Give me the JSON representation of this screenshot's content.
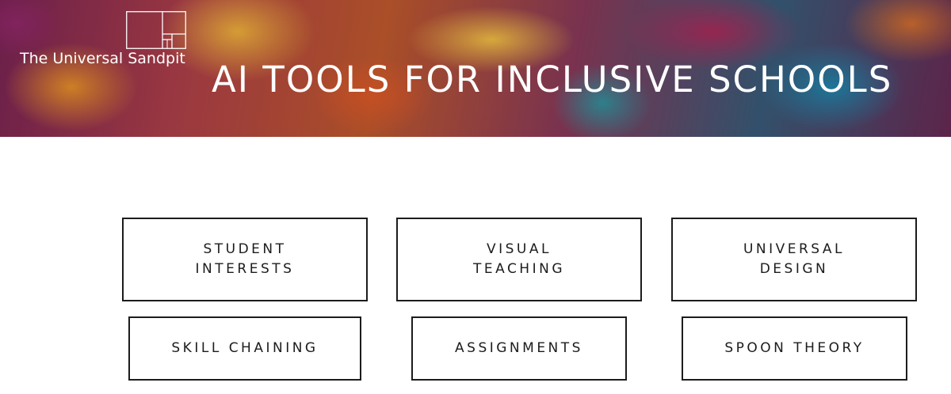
{
  "header": {
    "logo_text": "The Universal Sandpit",
    "title": "AI TOOLS FOR INCLUSIVE SCHOOLS"
  },
  "tiles": [
    {
      "label_line1": "STUDENT",
      "label_line2": "INTERESTS"
    },
    {
      "label_line1": "VISUAL",
      "label_line2": "TEACHING"
    },
    {
      "label_line1": "UNIVERSAL",
      "label_line2": "DESIGN"
    },
    {
      "label_line1": "SKILL CHAINING",
      "label_line2": ""
    },
    {
      "label_line1": "ASSIGNMENTS",
      "label_line2": ""
    },
    {
      "label_line1": "SPOON THEORY",
      "label_line2": ""
    }
  ]
}
